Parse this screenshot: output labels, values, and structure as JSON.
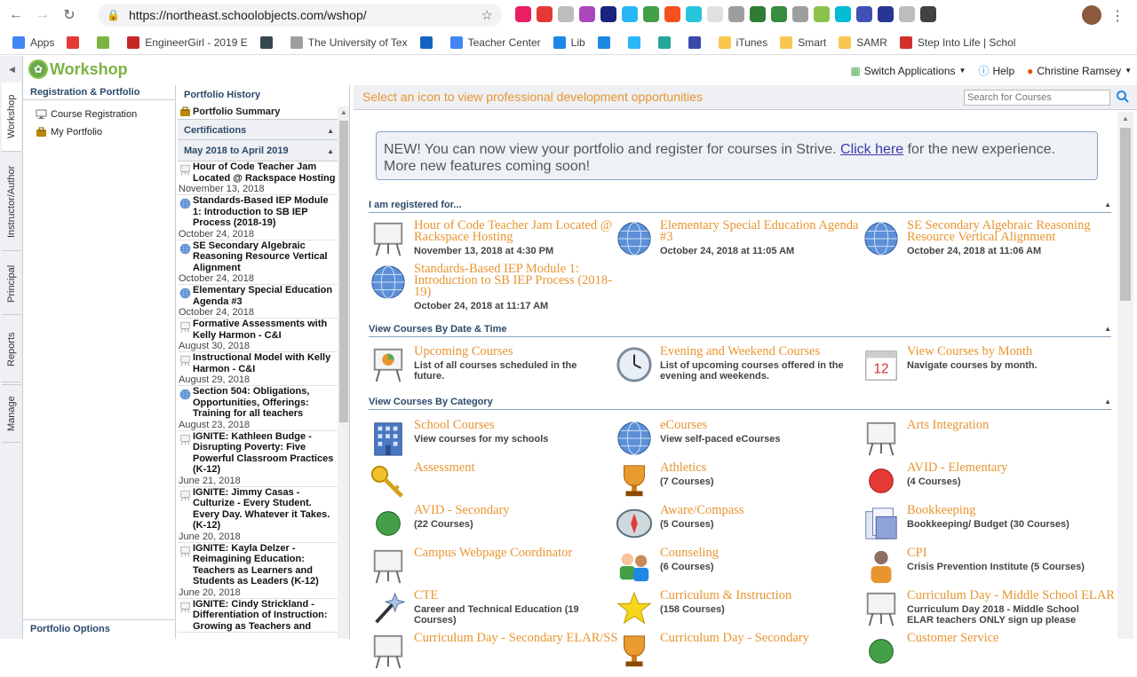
{
  "browser": {
    "url": "https://northeast.schoolobjects.com/wshop/",
    "bookmarks": [
      {
        "label": "Apps",
        "color": "#4285f4"
      },
      {
        "label": "",
        "color": "#e53935"
      },
      {
        "label": "",
        "color": "#7cb342"
      },
      {
        "label": "EngineerGirl - 2019 E",
        "color": "#c62828"
      },
      {
        "label": "",
        "color": "#37474f"
      },
      {
        "label": "The University of Tex",
        "color": "#9e9e9e"
      },
      {
        "label": "",
        "color": "#1565c0"
      },
      {
        "label": "Teacher Center",
        "color": "#4285f4"
      },
      {
        "label": "Lib",
        "color": "#1e88e5"
      },
      {
        "label": "",
        "color": "#1e88e5"
      },
      {
        "label": "",
        "color": "#29b6f6"
      },
      {
        "label": "",
        "color": "#26a69a"
      },
      {
        "label": "",
        "color": "#3949ab"
      },
      {
        "label": "iTunes",
        "color": "#f9c74f"
      },
      {
        "label": "Smart",
        "color": "#f9c74f"
      },
      {
        "label": "SAMR",
        "color": "#f9c74f"
      },
      {
        "label": "Step Into Life | Schol",
        "color": "#d32f2f"
      }
    ]
  },
  "app": {
    "logo": "Workshop",
    "switch_apps": "Switch Applications",
    "help": "Help",
    "user": "Christine Ramsey",
    "vertical_tabs": [
      "Workshop",
      "Instructor/Author",
      "Principal",
      "Reports",
      "Manage"
    ]
  },
  "leftnav": {
    "title": "Registration & Portfolio",
    "items": [
      "Course Registration",
      "My Portfolio"
    ],
    "options": "Portfolio Options"
  },
  "history": {
    "title": "Portfolio History",
    "summary": "Portfolio Summary",
    "certifications": "Certifications",
    "range": "May 2018 to April 2019",
    "entries": [
      {
        "title": "Hour of Code Teacher Jam Located @ Rackspace Hosting",
        "date": "November 13, 2018",
        "icon": "easel"
      },
      {
        "title": "Standards-Based IEP Module 1: Introduction to SB IEP Process (2018-19)",
        "date": "October 24, 2018",
        "icon": "globe"
      },
      {
        "title": "SE Secondary Algebraic Reasoning Resource Vertical Alignment",
        "date": "October 24, 2018",
        "icon": "globe"
      },
      {
        "title": "Elementary Special Education Agenda #3",
        "date": "October 24, 2018",
        "icon": "globe"
      },
      {
        "title": "Formative Assessments with Kelly Harmon - C&I",
        "date": "August 30, 2018",
        "icon": "easel"
      },
      {
        "title": "Instructional Model with Kelly Harmon - C&I",
        "date": "August 29, 2018",
        "icon": "easel"
      },
      {
        "title": "Section 504: Obligations, Opportunities, Offerings: Training for all teachers",
        "date": "August 23, 2018",
        "icon": "globe"
      },
      {
        "title": "IGNITE: Kathleen Budge - Disrupting Poverty: Five Powerful Classroom Practices (K-12)",
        "date": "June 21, 2018",
        "icon": "easel"
      },
      {
        "title": "IGNITE: Jimmy Casas - Culturize - Every Student. Every Day. Whatever it Takes. (K-12)",
        "date": "June 20, 2018",
        "icon": "easel"
      },
      {
        "title": "IGNITE: Kayla Delzer - Reimagining Education: Teachers as Learners and Students as Leaders (K-12)",
        "date": "June 20, 2018",
        "icon": "easel"
      },
      {
        "title": "IGNITE: Cindy Strickland - Differentiation of Instruction: Growing as Teachers and",
        "date": "",
        "icon": "easel"
      }
    ]
  },
  "main": {
    "prompt": "Select an icon to view professional development opportunities",
    "search_placeholder": "Search for Courses",
    "notice_pre": "NEW! You can now view your portfolio and register for courses in Strive. ",
    "notice_link": "Click here",
    "notice_post": " for the new experience. More new features coming soon!",
    "registered_header": "I am registered for...",
    "registered": [
      {
        "title": "Hour of Code Teacher Jam Located @ Rackspace Hosting",
        "sub": "November 13, 2018 at 4:30 PM",
        "icon": "easel"
      },
      {
        "title": "Elementary Special Education Agenda #3",
        "sub": "October 24, 2018 at 11:05 AM",
        "icon": "globe"
      },
      {
        "title": "SE Secondary Algebraic Reasoning Resource Vertical Alignment",
        "sub": "October 24, 2018 at 11:06 AM",
        "icon": "globe"
      },
      {
        "title": "Standards-Based IEP Module 1: Introduction to SB IEP Process (2018-19)",
        "sub": "October 24, 2018 at 11:17 AM",
        "icon": "globe"
      }
    ],
    "datetime_header": "View Courses By Date & Time",
    "datetime": [
      {
        "title": "Upcoming Courses",
        "sub": "List of all courses scheduled in the future.",
        "icon": "easel-chart"
      },
      {
        "title": "Evening and Weekend Courses",
        "sub": "List of upcoming courses offered in the evening and weekends.",
        "icon": "clock"
      },
      {
        "title": "View Courses by Month",
        "sub": "Navigate courses by month.",
        "icon": "calendar"
      }
    ],
    "category_header": "View Courses By Category",
    "categories": [
      {
        "title": "School Courses",
        "sub": "View courses for my schools",
        "icon": "building"
      },
      {
        "title": "eCourses",
        "sub": "View self-paced eCourses",
        "icon": "globe"
      },
      {
        "title": "Arts Integration",
        "sub": "",
        "icon": "easel"
      },
      {
        "title": "Assessment",
        "sub": "",
        "icon": "key"
      },
      {
        "title": "Athletics",
        "sub": "(7 Courses)",
        "icon": "trophy"
      },
      {
        "title": "AVID - Elementary",
        "sub": "(4 Courses)",
        "icon": "red-dot"
      },
      {
        "title": "AVID - Secondary",
        "sub": "(22 Courses)",
        "icon": "green-dot"
      },
      {
        "title": "Aware/Compass",
        "sub": "(5 Courses)",
        "icon": "compass"
      },
      {
        "title": "Bookkeeping",
        "sub": "Bookkeeping/ Budget (30 Courses)",
        "icon": "docs"
      },
      {
        "title": "Campus Webpage Coordinator",
        "sub": "",
        "icon": "easel"
      },
      {
        "title": "Counseling",
        "sub": "(6 Courses)",
        "icon": "people"
      },
      {
        "title": "CPI",
        "sub": "Crisis Prevention Institute (5 Courses)",
        "icon": "person"
      },
      {
        "title": "CTE",
        "sub": "Career and Technical Education (19 Courses)",
        "icon": "wand"
      },
      {
        "title": "Curriculum & Instruction",
        "sub": "(158 Courses)",
        "icon": "star"
      },
      {
        "title": "Curriculum Day - Middle School ELAR",
        "sub": "Curriculum Day 2018 - Middle School ELAR teachers ONLY sign up please",
        "icon": "easel"
      },
      {
        "title": "Curriculum Day - Secondary ELAR/SS",
        "sub": "",
        "icon": "easel"
      },
      {
        "title": "Curriculum Day - Secondary",
        "sub": "",
        "icon": "trophy"
      },
      {
        "title": "Customer Service",
        "sub": "",
        "icon": "green-dot"
      }
    ]
  }
}
